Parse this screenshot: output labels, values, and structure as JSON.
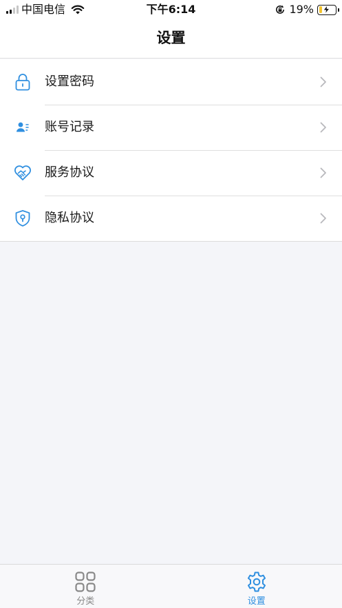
{
  "status_bar": {
    "carrier": "中国电信",
    "time": "下午6:14",
    "battery_percent": "19%",
    "battery_level": 0.19,
    "icons": [
      "signal-icon",
      "wifi-icon",
      "orientation-lock-icon",
      "battery-charging-icon"
    ]
  },
  "nav": {
    "title": "设置"
  },
  "settings": {
    "items": [
      {
        "label": "设置密码",
        "icon": "lock-icon"
      },
      {
        "label": "账号记录",
        "icon": "account-record-icon"
      },
      {
        "label": "服务协议",
        "icon": "handshake-heart-icon"
      },
      {
        "label": "隐私协议",
        "icon": "shield-lock-icon"
      }
    ]
  },
  "tab_bar": {
    "tabs": [
      {
        "label": "分类",
        "icon": "grid-icon",
        "active": false
      },
      {
        "label": "设置",
        "icon": "gear-icon",
        "active": true
      }
    ]
  },
  "colors": {
    "accent": "#2f8fe0",
    "inactive_tab": "#888888",
    "background": "#f4f5f9"
  }
}
